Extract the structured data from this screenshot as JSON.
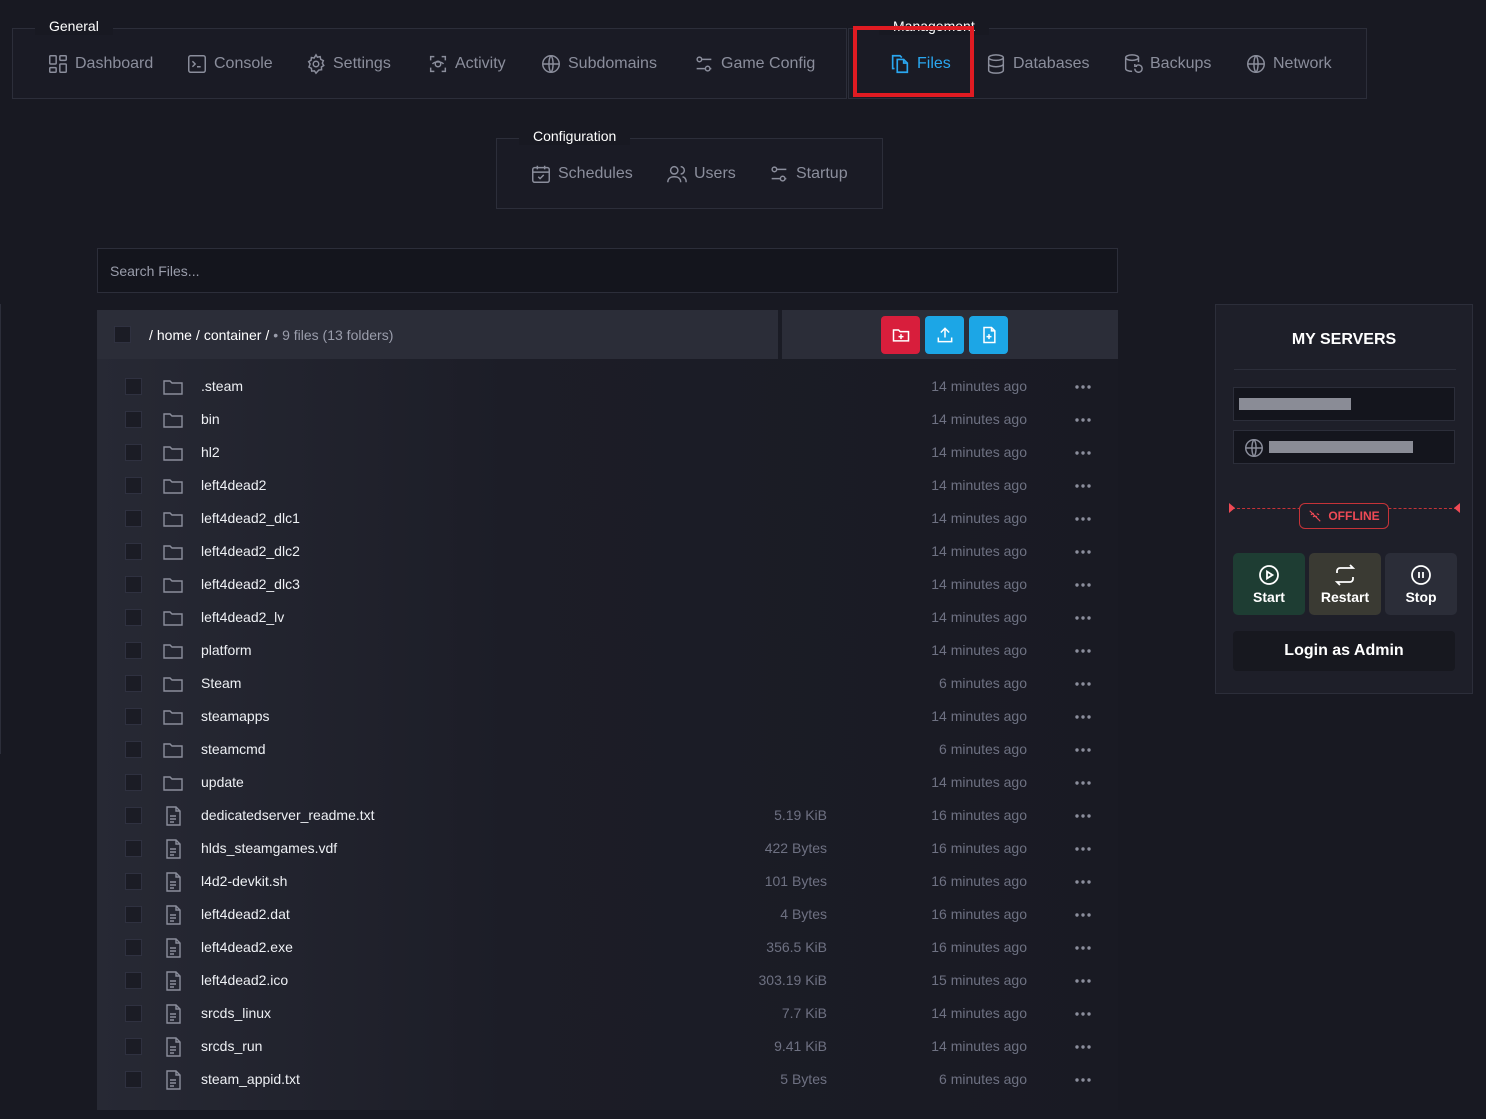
{
  "nav": {
    "general": {
      "label": "General",
      "items": [
        {
          "label": "Dashboard",
          "icon": "dashboard-icon"
        },
        {
          "label": "Console",
          "icon": "console-icon"
        },
        {
          "label": "Settings",
          "icon": "gear-icon"
        },
        {
          "label": "Activity",
          "icon": "activity-icon"
        },
        {
          "label": "Subdomains",
          "icon": "globe-icon"
        },
        {
          "label": "Game Config",
          "icon": "sliders-icon"
        }
      ]
    },
    "management": {
      "label": "Management",
      "items": [
        {
          "label": "Files",
          "icon": "files-icon",
          "active": true
        },
        {
          "label": "Databases",
          "icon": "database-icon"
        },
        {
          "label": "Backups",
          "icon": "backup-icon"
        },
        {
          "label": "Network",
          "icon": "globe-icon"
        }
      ]
    },
    "configuration": {
      "label": "Configuration",
      "items": [
        {
          "label": "Schedules",
          "icon": "calendar-icon"
        },
        {
          "label": "Users",
          "icon": "users-icon"
        },
        {
          "label": "Startup",
          "icon": "sliders-icon"
        }
      ]
    }
  },
  "search": {
    "placeholder": "Search Files..."
  },
  "path": {
    "root_sep": "/",
    "seg1": "home",
    "sep1": "/",
    "seg2": "container",
    "sep2": "/",
    "summary": "• 9 files (13 folders)"
  },
  "colors": {
    "accent": "#2aa7f0",
    "new_folder_button": "#d81e3c",
    "upload_button": "#1ca6e6",
    "new_file_button": "#1ca6e6",
    "offline": "#ef4a55",
    "highlight": "#e01b22"
  },
  "files": [
    {
      "name": ".steam",
      "type": "folder",
      "size": "",
      "modified": "14 minutes ago"
    },
    {
      "name": "bin",
      "type": "folder",
      "size": "",
      "modified": "14 minutes ago"
    },
    {
      "name": "hl2",
      "type": "folder",
      "size": "",
      "modified": "14 minutes ago"
    },
    {
      "name": "left4dead2",
      "type": "folder",
      "size": "",
      "modified": "14 minutes ago"
    },
    {
      "name": "left4dead2_dlc1",
      "type": "folder",
      "size": "",
      "modified": "14 minutes ago"
    },
    {
      "name": "left4dead2_dlc2",
      "type": "folder",
      "size": "",
      "modified": "14 minutes ago"
    },
    {
      "name": "left4dead2_dlc3",
      "type": "folder",
      "size": "",
      "modified": "14 minutes ago"
    },
    {
      "name": "left4dead2_lv",
      "type": "folder",
      "size": "",
      "modified": "14 minutes ago"
    },
    {
      "name": "platform",
      "type": "folder",
      "size": "",
      "modified": "14 minutes ago"
    },
    {
      "name": "Steam",
      "type": "folder",
      "size": "",
      "modified": "6 minutes ago"
    },
    {
      "name": "steamapps",
      "type": "folder",
      "size": "",
      "modified": "14 minutes ago"
    },
    {
      "name": "steamcmd",
      "type": "folder",
      "size": "",
      "modified": "6 minutes ago"
    },
    {
      "name": "update",
      "type": "folder",
      "size": "",
      "modified": "14 minutes ago"
    },
    {
      "name": "dedicatedserver_readme.txt",
      "type": "file",
      "size": "5.19 KiB",
      "modified": "16 minutes ago"
    },
    {
      "name": "hlds_steamgames.vdf",
      "type": "file",
      "size": "422 Bytes",
      "modified": "16 minutes ago"
    },
    {
      "name": "l4d2-devkit.sh",
      "type": "file",
      "size": "101 Bytes",
      "modified": "16 minutes ago"
    },
    {
      "name": "left4dead2.dat",
      "type": "file",
      "size": "4 Bytes",
      "modified": "16 minutes ago"
    },
    {
      "name": "left4dead2.exe",
      "type": "file",
      "size": "356.5 KiB",
      "modified": "16 minutes ago"
    },
    {
      "name": "left4dead2.ico",
      "type": "file",
      "size": "303.19 KiB",
      "modified": "15 minutes ago"
    },
    {
      "name": "srcds_linux",
      "type": "file",
      "size": "7.7 KiB",
      "modified": "14 minutes ago"
    },
    {
      "name": "srcds_run",
      "type": "file",
      "size": "9.41 KiB",
      "modified": "14 minutes ago"
    },
    {
      "name": "steam_appid.txt",
      "type": "file",
      "size": "5 Bytes",
      "modified": "6 minutes ago"
    }
  ],
  "server_panel": {
    "title": "MY SERVERS",
    "status": "OFFLINE",
    "buttons": {
      "start": "Start",
      "restart": "Restart",
      "stop": "Stop"
    },
    "login": "Login as Admin"
  }
}
